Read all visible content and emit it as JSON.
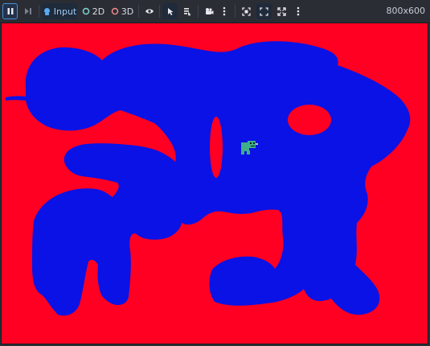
{
  "toolbar": {
    "input_label": "Input",
    "mode_2d_label": "2D",
    "mode_3d_label": "3D",
    "resolution": "800x600"
  },
  "colors": {
    "background_red": "#ff0022",
    "foreground_blue": "#0a12e6",
    "sprite": "#3fae8a",
    "accent": "#4a8fd9"
  },
  "icons": [
    "pause-icon",
    "step-frame-icon",
    "input-icon",
    "circle-2d-icon",
    "circle-3d-icon",
    "visibility-eye-icon",
    "select-cursor-icon",
    "list-select-icon",
    "camera-override-icon",
    "more-vertical-icon",
    "screenshot-frame-icon",
    "fit-frame-icon",
    "expand-icon",
    "more-vertical-icon-2"
  ]
}
